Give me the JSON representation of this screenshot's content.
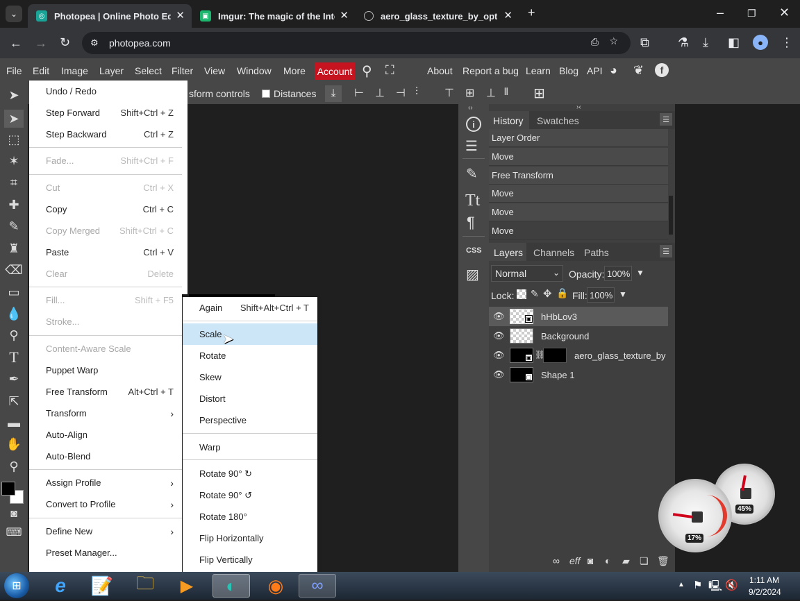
{
  "browser": {
    "tabs": [
      {
        "title": "Photopea | Online Photo Editor",
        "active": true
      },
      {
        "title": "Imgur: The magic of the Internet",
        "active": false
      },
      {
        "title": "aero_glass_texture_by_optimus",
        "active": false
      }
    ],
    "url": "photopea.com"
  },
  "menubar": {
    "items": [
      "File",
      "Edit",
      "Image",
      "Layer",
      "Select",
      "Filter",
      "View",
      "Window",
      "More"
    ],
    "account": "Account",
    "links": [
      "About",
      "Report a bug",
      "Learn",
      "Blog",
      "API"
    ]
  },
  "options": {
    "transform_controls": "sform controls",
    "distances": "Distances"
  },
  "edit_menu": {
    "items": [
      {
        "label": "Undo / Redo",
        "shortcut": "",
        "disabled": false
      },
      {
        "label": "Step Forward",
        "shortcut": "Shift+Ctrl + Z",
        "disabled": false
      },
      {
        "label": "Step Backward",
        "shortcut": "Ctrl + Z",
        "disabled": false
      },
      {
        "label": "Fade...",
        "shortcut": "Shift+Ctrl + F",
        "disabled": true
      },
      {
        "label": "Cut",
        "shortcut": "Ctrl + X",
        "disabled": true
      },
      {
        "label": "Copy",
        "shortcut": "Ctrl + C",
        "disabled": false
      },
      {
        "label": "Copy Merged",
        "shortcut": "Shift+Ctrl + C",
        "disabled": true
      },
      {
        "label": "Paste",
        "shortcut": "Ctrl + V",
        "disabled": false
      },
      {
        "label": "Clear",
        "shortcut": "Delete",
        "disabled": true
      },
      {
        "label": "Fill...",
        "shortcut": "Shift + F5",
        "disabled": true
      },
      {
        "label": "Stroke...",
        "shortcut": "",
        "disabled": true
      },
      {
        "label": "Content-Aware Scale",
        "shortcut": "",
        "disabled": true
      },
      {
        "label": "Puppet Warp",
        "shortcut": "",
        "disabled": false
      },
      {
        "label": "Free Transform",
        "shortcut": "Alt+Ctrl + T",
        "disabled": false
      },
      {
        "label": "Transform",
        "shortcut": "",
        "disabled": false
      },
      {
        "label": "Auto-Align",
        "shortcut": "",
        "disabled": false
      },
      {
        "label": "Auto-Blend",
        "shortcut": "",
        "disabled": false
      },
      {
        "label": "Assign Profile",
        "shortcut": "",
        "disabled": false
      },
      {
        "label": "Convert to Profile",
        "shortcut": "",
        "disabled": false
      },
      {
        "label": "Define New",
        "shortcut": "",
        "disabled": false
      },
      {
        "label": "Preset Manager...",
        "shortcut": "",
        "disabled": false
      }
    ]
  },
  "transform_menu": {
    "items": [
      {
        "label": "Again",
        "shortcut": "Shift+Alt+Ctrl + T"
      },
      {
        "label": "Scale",
        "shortcut": ""
      },
      {
        "label": "Rotate",
        "shortcut": ""
      },
      {
        "label": "Skew",
        "shortcut": ""
      },
      {
        "label": "Distort",
        "shortcut": ""
      },
      {
        "label": "Perspective",
        "shortcut": ""
      },
      {
        "label": "Warp",
        "shortcut": ""
      },
      {
        "label": "Rotate 90° ↻",
        "shortcut": ""
      },
      {
        "label": "Rotate 90° ↺",
        "shortcut": ""
      },
      {
        "label": "Rotate 180°",
        "shortcut": ""
      },
      {
        "label": "Flip Horizontally",
        "shortcut": ""
      },
      {
        "label": "Flip Vertically",
        "shortcut": ""
      }
    ],
    "highlighted": "Scale"
  },
  "side_icons": {
    "css_label": "CSS"
  },
  "history": {
    "tabs": [
      "History",
      "Swatches"
    ],
    "items": [
      "Layer Order",
      "Move",
      "Free Transform",
      "Move",
      "Move",
      "Move"
    ]
  },
  "layers_panel": {
    "tabs": [
      "Layers",
      "Channels",
      "Paths"
    ],
    "blend_mode": "Normal",
    "opacity_label": "Opacity:",
    "opacity": "100%",
    "lock_label": "Lock:",
    "fill_label": "Fill:",
    "fill": "100%",
    "layers": [
      "hHbLov3",
      "Background",
      "aero_glass_texture_by",
      "Shape 1"
    ]
  },
  "gadget": {
    "cpu": "17%",
    "mem": "45%"
  },
  "taskbar": {
    "time": "1:11 AM",
    "date": "9/2/2024"
  },
  "colors": {
    "accent_red": "#c5131f",
    "menu_highlight": "#cce6f7",
    "panel": "#474747"
  }
}
